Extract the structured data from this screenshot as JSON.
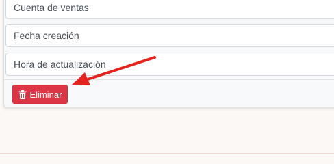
{
  "fields": [
    {
      "label": "Cuenta de ventas"
    },
    {
      "label": "Fecha creación"
    },
    {
      "label": "Hora de actualización"
    }
  ],
  "actions": {
    "delete_label": "Eliminar",
    "delete_icon": "trash-icon",
    "delete_color": "#dc3545"
  },
  "annotation": {
    "arrow_icon": "red-arrow",
    "arrow_color": "#e52420"
  }
}
